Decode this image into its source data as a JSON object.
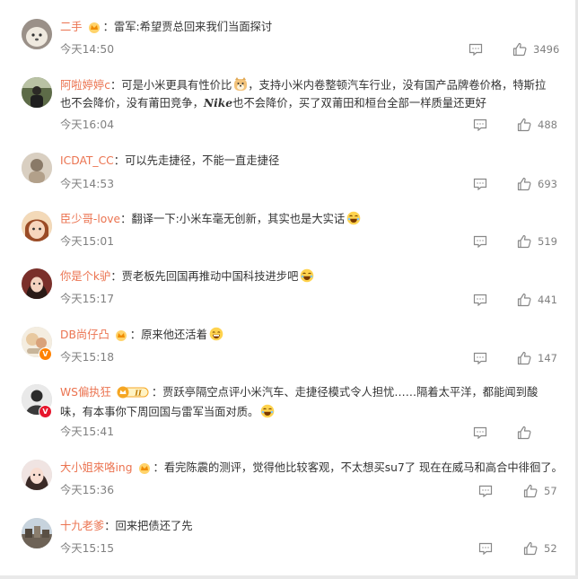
{
  "comments": [
    {
      "name": "二手",
      "text": "雷军:希望贾总回来我们当面探讨",
      "time": "今天14:50",
      "likes": "3496"
    },
    {
      "name": "阿啦婷婷c",
      "text_a": "可是小米更具有性价比",
      "text_b": "，支持小米内卷整顿汽车行业，没有国产品牌卷价格，特斯拉也不会降价，没有莆田竞争，",
      "text_nike": "Nike",
      "text_c": "也不会降价，买了双莆田和桓台全部一样质量还更好",
      "time": "今天16:04",
      "likes": "488"
    },
    {
      "name": "ICDAT_CC",
      "text": "可以先走捷径，不能一直走捷径",
      "time": "今天14:53",
      "likes": "693"
    },
    {
      "name": "臣少哥-love",
      "text": "翻译一下:小米车毫无创新，其实也是大实话",
      "time": "今天15:01",
      "likes": "519"
    },
    {
      "name": "你是个k驴",
      "text": "贾老板先回国再推动中国科技进步吧",
      "time": "今天15:17",
      "likes": "441"
    },
    {
      "name": "DB尚仔凸",
      "text": "原来他还活着",
      "time": "今天15:18",
      "likes": "147"
    },
    {
      "name": "WS偏执狂",
      "level": "II",
      "text": "贾跃亭隔空点评小米汽车、走捷径模式令人担忧……隔着太平洋，都能闻到酸味，有本事你下周回国与雷军当面对质。",
      "time": "今天15:41",
      "likes": ""
    },
    {
      "name": "大小姐來咯ing",
      "text": "看完陈震的测评，觉得他比较客观，不太想买su7了 现在在威马和高合中徘徊了。",
      "time": "今天15:36",
      "likes": "57"
    },
    {
      "name": "十九老爹",
      "text": "回来把债还了先",
      "time": "今天15:15",
      "likes": "52"
    }
  ],
  "colors": {
    "username": "#eb7350",
    "meta": "#808080",
    "text": "#333333",
    "vip_gold": "#f5a623",
    "verify_orange": "#ff8200",
    "verify_red": "#e6162d"
  },
  "icons": {
    "comment": "comment-icon",
    "like": "thumbs-up-icon",
    "member": "crown-icon"
  }
}
